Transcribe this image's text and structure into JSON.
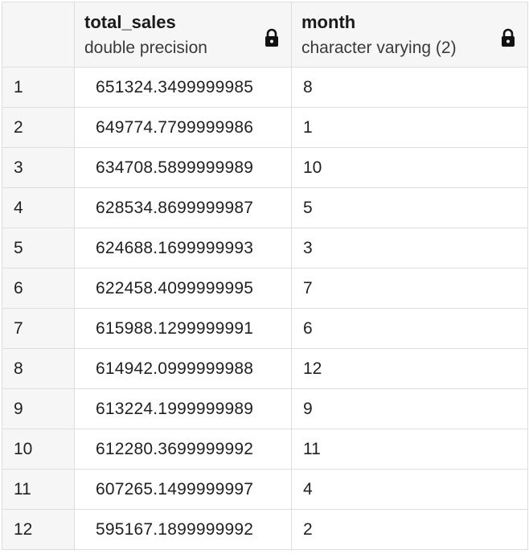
{
  "columns": [
    {
      "name": "total_sales",
      "type": "double precision",
      "icon": "lock-icon"
    },
    {
      "name": "month",
      "type": "character varying (2)",
      "icon": "lock-icon"
    }
  ],
  "rows": [
    {
      "num": "1",
      "total_sales": "651324.3499999985",
      "month": "8"
    },
    {
      "num": "2",
      "total_sales": "649774.7799999986",
      "month": "1"
    },
    {
      "num": "3",
      "total_sales": "634708.5899999989",
      "month": "10"
    },
    {
      "num": "4",
      "total_sales": "628534.8699999987",
      "month": "5"
    },
    {
      "num": "5",
      "total_sales": "624688.1699999993",
      "month": "3"
    },
    {
      "num": "6",
      "total_sales": "622458.4099999995",
      "month": "7"
    },
    {
      "num": "7",
      "total_sales": "615988.1299999991",
      "month": "6"
    },
    {
      "num": "8",
      "total_sales": "614942.0999999988",
      "month": "12"
    },
    {
      "num": "9",
      "total_sales": "613224.1999999989",
      "month": "9"
    },
    {
      "num": "10",
      "total_sales": "612280.3699999992",
      "month": "11"
    },
    {
      "num": "11",
      "total_sales": "607265.1499999997",
      "month": "4"
    },
    {
      "num": "12",
      "total_sales": "595167.1899999992",
      "month": "2"
    }
  ],
  "colors": {
    "header_bg": "#f6f6f6",
    "border": "#dedede",
    "text": "#212121"
  }
}
